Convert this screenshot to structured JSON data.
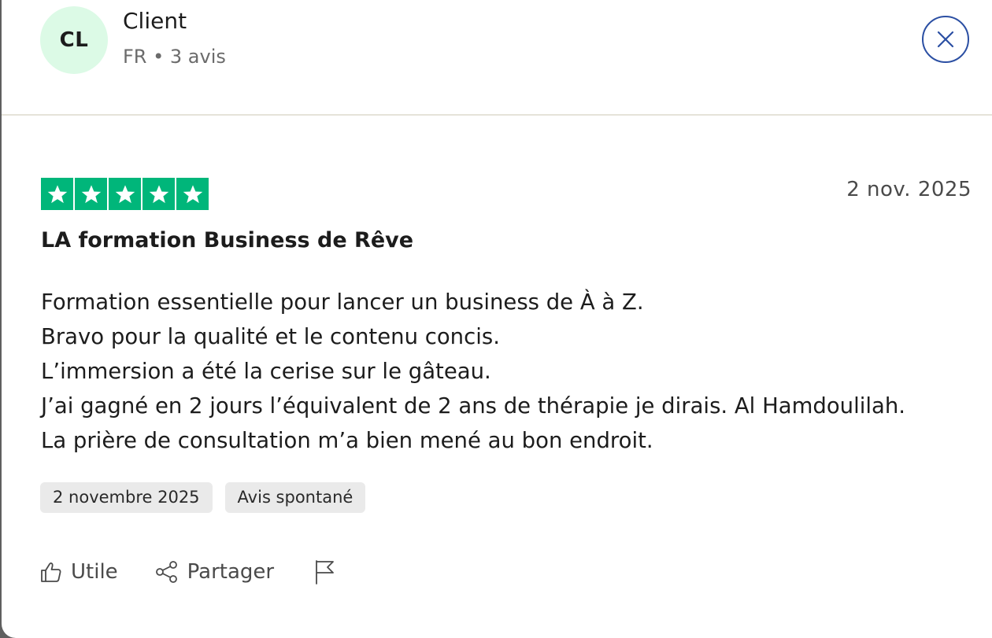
{
  "reviewer": {
    "initials": "CL",
    "name": "Client",
    "meta": "FR • 3 avis"
  },
  "review": {
    "rating": 5,
    "star_color": "#00b67a",
    "date": "2 nov. 2025",
    "title": "LA formation Business de Rêve",
    "lines": [
      "Formation essentielle pour lancer un business de À à Z.",
      "Bravo pour la qualité et le contenu concis.",
      "L’immersion a été la cerise sur le gâteau.",
      "J’ai gagné en 2 jours l’équivalent de 2 ans de thérapie je dirais. Al Hamdoulilah.",
      "La prière de consultation m’a bien mené au bon endroit."
    ],
    "tags": [
      "2 novembre 2025",
      "Avis spontané"
    ]
  },
  "actions": {
    "useful_label": "Utile",
    "share_label": "Partager"
  },
  "icons": {
    "close": "close-icon",
    "useful": "thumbs-up-icon",
    "share": "share-icon",
    "report": "flag-icon"
  },
  "colors": {
    "avatar_bg": "#dcfae6",
    "close_border": "#2b4fa3"
  }
}
